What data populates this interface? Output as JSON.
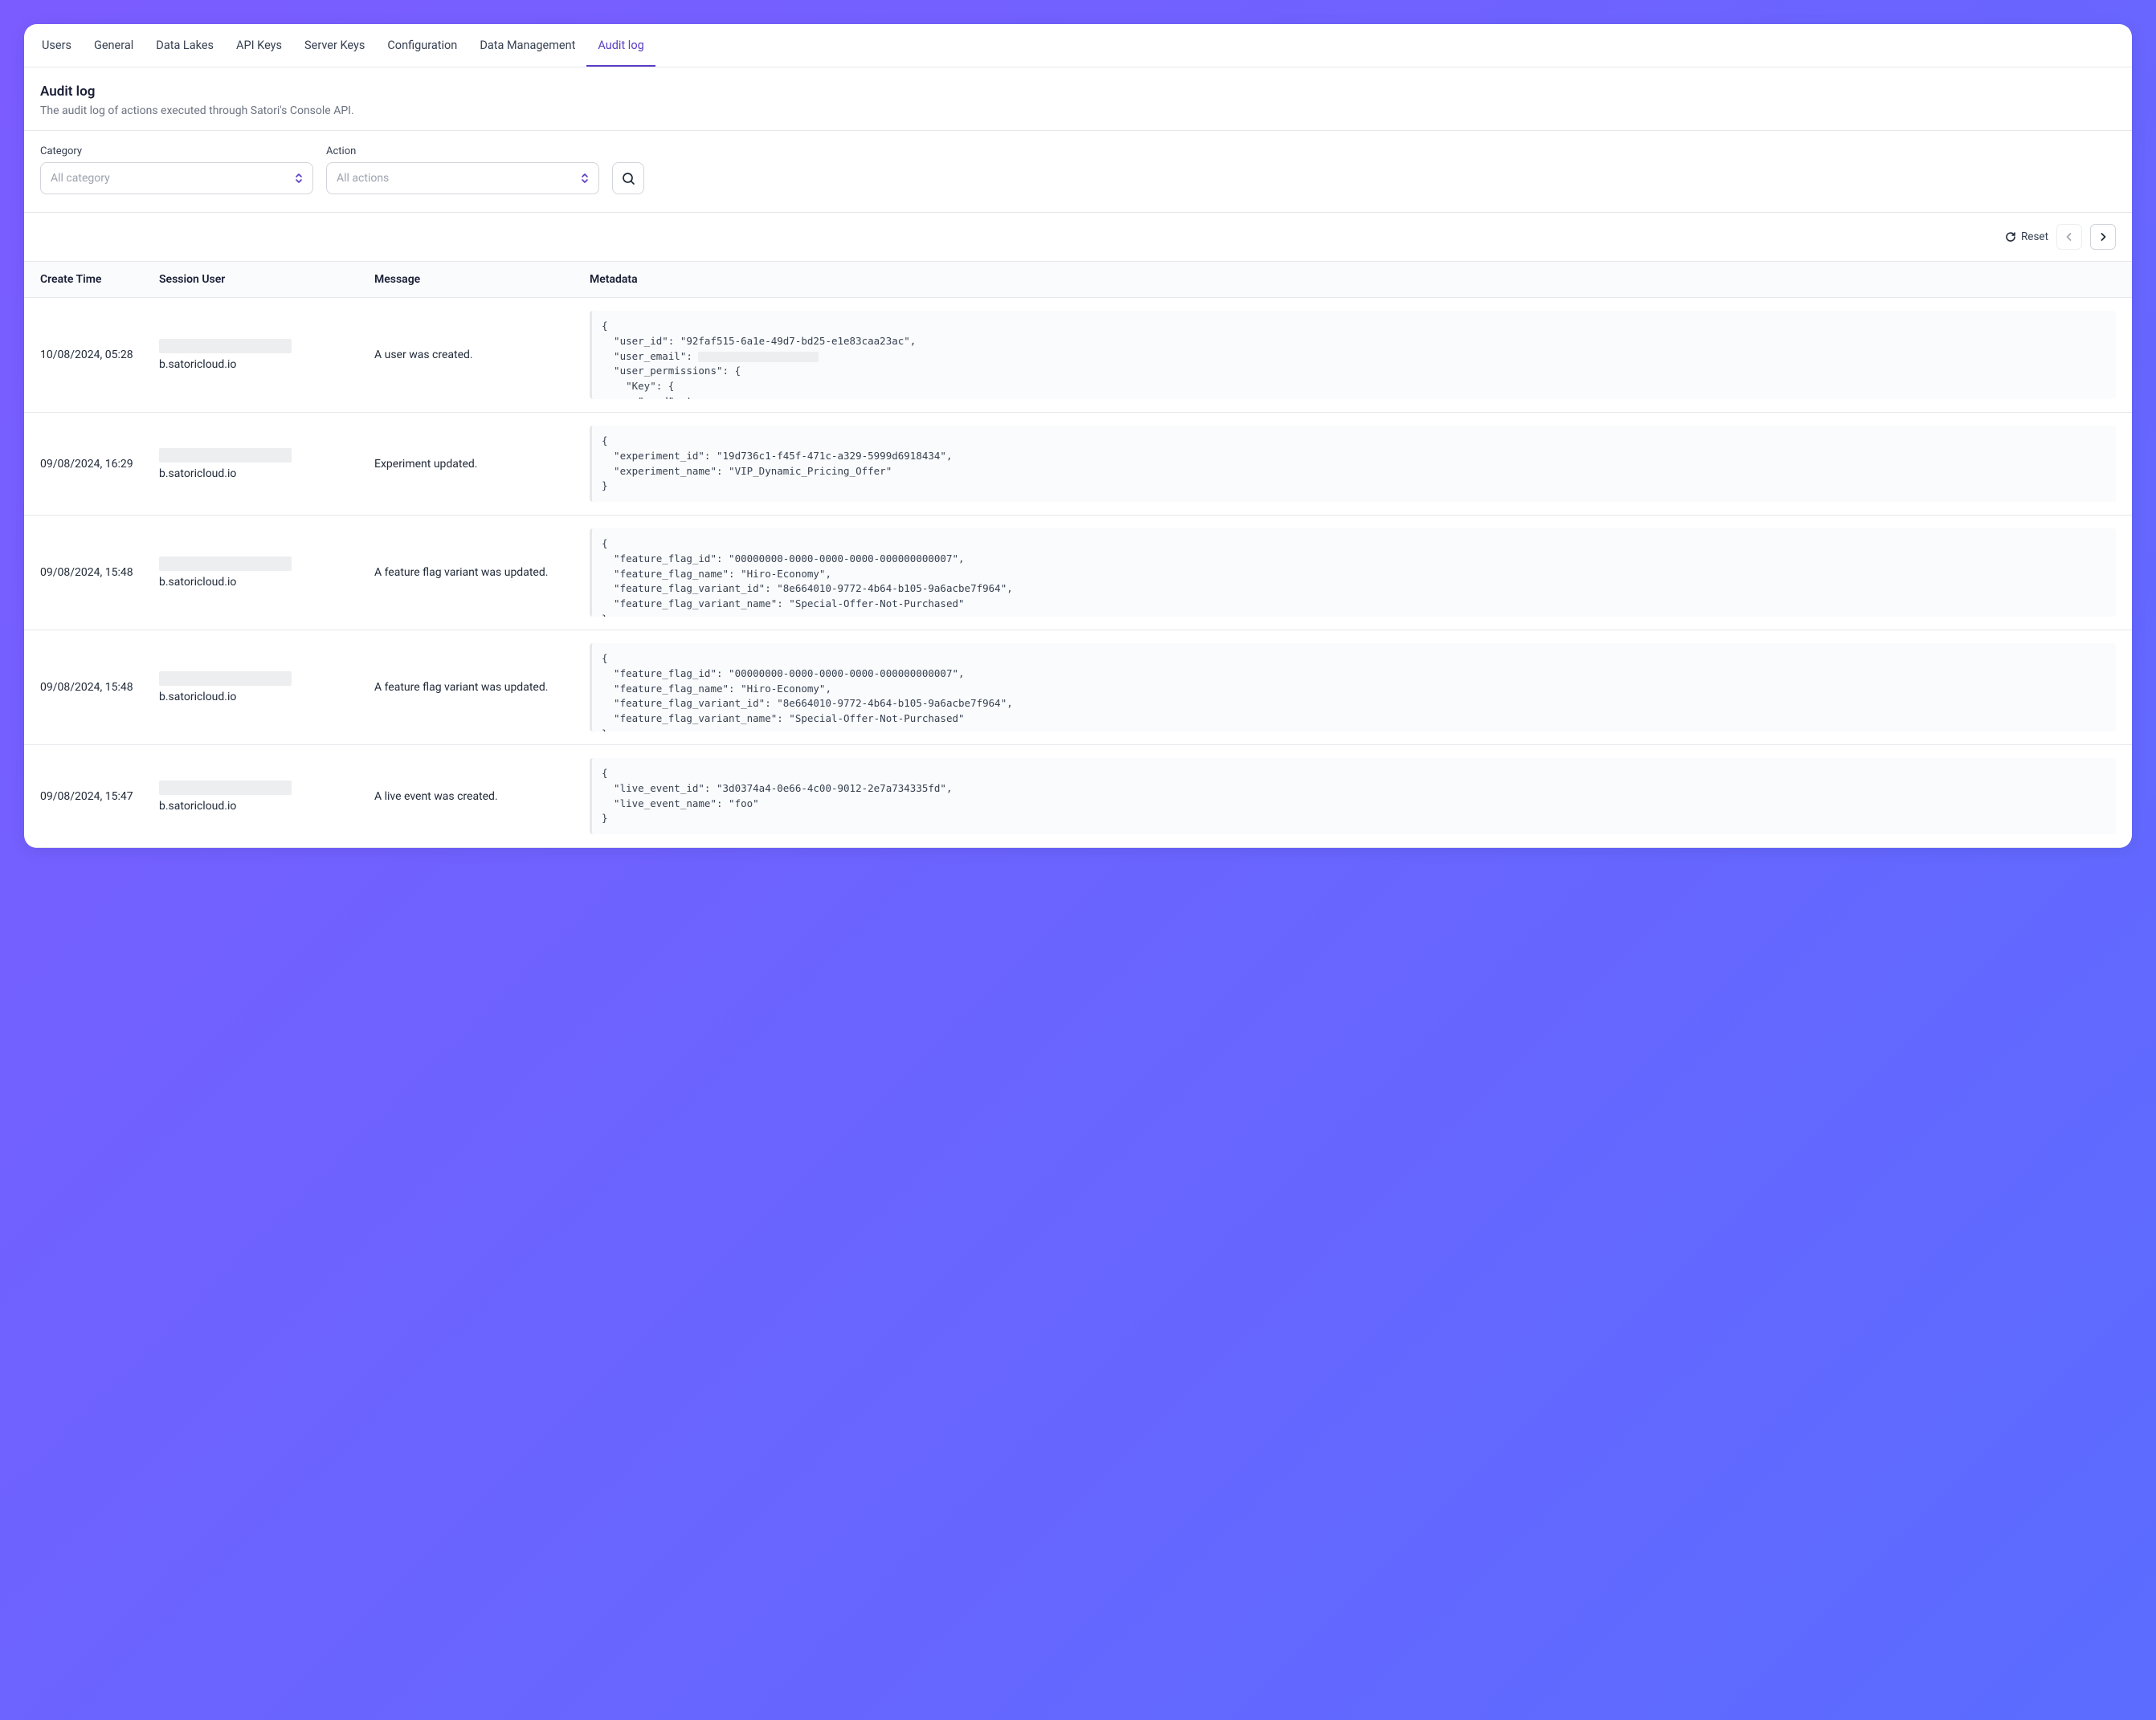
{
  "tabs": [
    "Users",
    "General",
    "Data Lakes",
    "API Keys",
    "Server Keys",
    "Configuration",
    "Data Management",
    "Audit log"
  ],
  "activeTab": "Audit log",
  "header": {
    "title": "Audit log",
    "subtitle": "The audit log of actions executed through Satori's Console API."
  },
  "filters": {
    "category_label": "Category",
    "category_placeholder": "All category",
    "action_label": "Action",
    "action_placeholder": "All actions"
  },
  "toolbar": {
    "reset_label": "Reset"
  },
  "columns": [
    "Create Time",
    "Session User",
    "Message",
    "Metadata"
  ],
  "rows": [
    {
      "time": "10/08/2024, 05:28",
      "user_domain": "b.satoricloud.io",
      "message": "A user was created.",
      "metadata": "{\n  \"user_id\": \"92faf515-6a1e-49d7-bd25-e1e83caa23ac\",\n  \"user_email\": [REDACTED]\n  \"user_permissions\": {\n    \"Key\": {\n      \"read\": true,\n      \"write\": true,"
    },
    {
      "time": "09/08/2024, 16:29",
      "user_domain": "b.satoricloud.io",
      "message": "Experiment updated.",
      "metadata": "{\n  \"experiment_id\": \"19d736c1-f45f-471c-a329-5999d6918434\",\n  \"experiment_name\": \"VIP_Dynamic_Pricing_Offer\"\n}"
    },
    {
      "time": "09/08/2024, 15:48",
      "user_domain": "b.satoricloud.io",
      "message": "A feature flag variant was updated.",
      "metadata": "{\n  \"feature_flag_id\": \"00000000-0000-0000-0000-000000000007\",\n  \"feature_flag_name\": \"Hiro-Economy\",\n  \"feature_flag_variant_id\": \"8e664010-9772-4b64-b105-9a6acbe7f964\",\n  \"feature_flag_variant_name\": \"Special-Offer-Not-Purchased\"\n}"
    },
    {
      "time": "09/08/2024, 15:48",
      "user_domain": "b.satoricloud.io",
      "message": "A feature flag variant was updated.",
      "metadata": "{\n  \"feature_flag_id\": \"00000000-0000-0000-0000-000000000007\",\n  \"feature_flag_name\": \"Hiro-Economy\",\n  \"feature_flag_variant_id\": \"8e664010-9772-4b64-b105-9a6acbe7f964\",\n  \"feature_flag_variant_name\": \"Special-Offer-Not-Purchased\"\n}"
    },
    {
      "time": "09/08/2024, 15:47",
      "user_domain": "b.satoricloud.io",
      "message": "A live event was created.",
      "metadata": "{\n  \"live_event_id\": \"3d0374a4-0e66-4c00-9012-2e7a734335fd\",\n  \"live_event_name\": \"foo\"\n}"
    }
  ]
}
